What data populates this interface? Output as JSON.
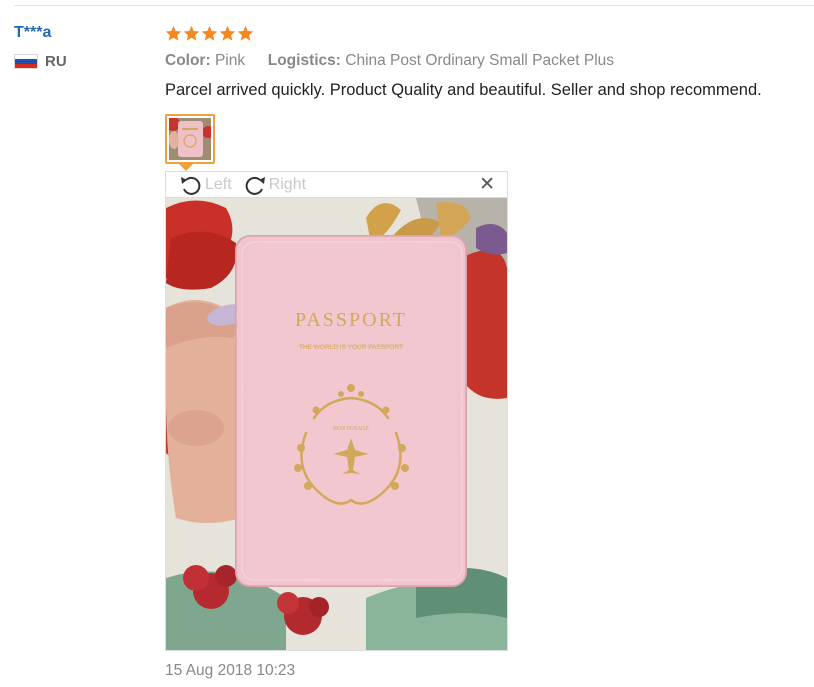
{
  "review": {
    "user": {
      "name": "T***a",
      "country_code": "RU",
      "flag_icon": "russia-flag-icon"
    },
    "rating": {
      "stars": 5,
      "max": 5,
      "star_color": "#f5891f"
    },
    "meta": {
      "color_label": "Color:",
      "color_value": "Pink",
      "logistics_label": "Logistics:",
      "logistics_value": "China Post Ordinary Small Packet Plus"
    },
    "text": "Parcel arrived quickly. Product Quality and beautiful. Seller and shop recommend.",
    "viewer": {
      "rotate_left_label": "Left",
      "rotate_right_label": "Right",
      "close_icon": "close-icon",
      "photo_text": {
        "title": "PASSPORT",
        "subtitle": "THE WORLD IS YOUR PASSPORT",
        "emblem_text": "BON VOYAGE"
      }
    },
    "date": "15 Aug 2018 10:23"
  },
  "colors": {
    "username": "#2468b8",
    "accent": "#f0a03c",
    "muted": "#888888",
    "passport_pink": "#eebcc4",
    "gold": "#d2a85a"
  }
}
